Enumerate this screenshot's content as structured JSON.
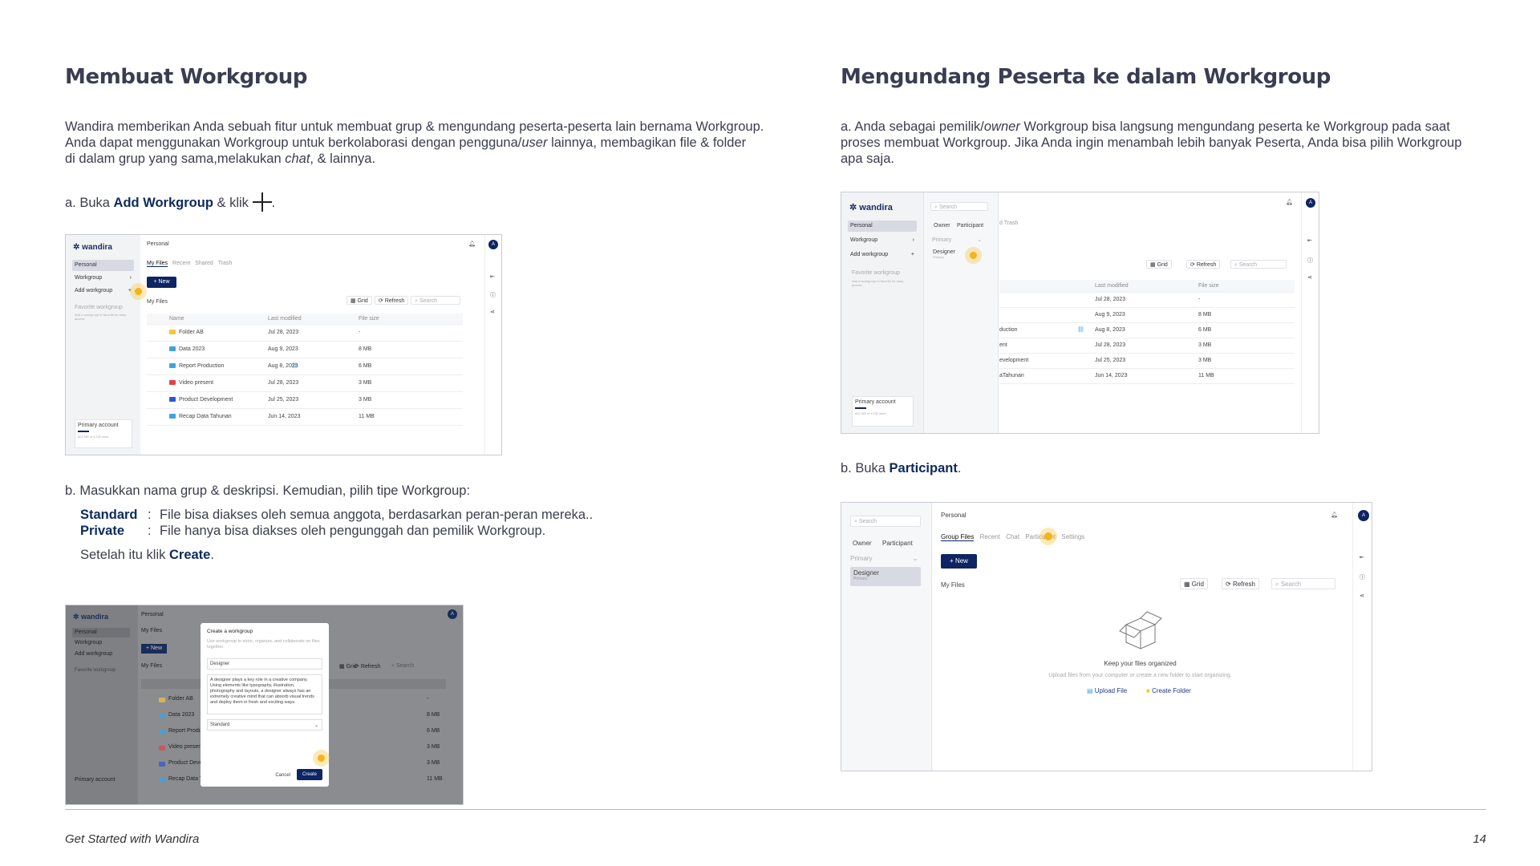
{
  "left": {
    "title": "Membuat Workgroup",
    "intro": [
      "Wandira memberikan Anda sebuah fitur untuk membuat grup & mengundang peserta-peserta lain bernama Workgroup.",
      "Anda dapat menggunakan Workgroup untuk berkolaborasi dengan pengguna/",
      "user",
      " lainnya, membagikan file & folder",
      "di dalam grup yang sama,melakukan ",
      "chat",
      ", & lainnya."
    ],
    "step_a": {
      "prefix": "a. Buka ",
      "bold": "Add Workgroup",
      "suffix": " & klik ",
      "end": "."
    },
    "step_b": "b. Masukkan nama grup & deskripsi. Kemudian, pilih tipe Workgroup:",
    "types": [
      {
        "name": "Standard",
        "sep": ":",
        "desc": "File bisa diakses oleh semua anggota, berdasarkan peran-peran mereka.."
      },
      {
        "name": "Private",
        "sep": ":",
        "desc": "File hanya bisa diakses oleh pengunggah dan pemilik Workgroup."
      }
    ],
    "after": {
      "prefix": "Setelah itu klik ",
      "bold": "Create",
      "end": "."
    }
  },
  "right": {
    "title": "Mengundang Peserta ke dalam Workgroup",
    "intro": [
      "a. Anda sebagai pemilik/",
      "owner",
      " Workgroup bisa langsung mengundang peserta ke Workgroup pada saat",
      "proses membuat Workgroup. Jika Anda ingin menambah lebih banyak Peserta, Anda bisa pilih Workgroup",
      "apa saja."
    ],
    "step_b": {
      "prefix": "b. Buka ",
      "bold": "Participant",
      "end": "."
    }
  },
  "app": {
    "logo": "wandira",
    "avatar": "A",
    "sidebar": [
      "Personal",
      "Workgroup",
      "Add workgroup"
    ],
    "fav_title": "Favorite workgroup",
    "fav_desc": "Add a workgroup to favorite for easy access",
    "primary_account": "Primary account",
    "storage": "802 MB of 5 GB used",
    "header": "Personal",
    "tabs": [
      "My Files",
      "Recent",
      "Shared",
      "Trash"
    ],
    "new": "+ New",
    "myfiles": "My Files",
    "grid": "Grid",
    "refresh": "Refresh",
    "search": "Search",
    "columns": [
      "Name",
      "Last modified",
      "File size"
    ],
    "files": [
      {
        "name": "Folder AB",
        "date": "Jul 28, 2023",
        "size": "-",
        "color": "#f4c542"
      },
      {
        "name": "Data 2023",
        "date": "Aug 9, 2023",
        "size": "8 MB",
        "color": "#3fa3e0"
      },
      {
        "name": "Report Production",
        "date": "Aug 8, 2023",
        "size": "6 MB",
        "color": "#3fa3e0"
      },
      {
        "name": "Video present",
        "date": "Jul 28, 2023",
        "size": "3 MB",
        "color": "#e04444"
      },
      {
        "name": "Product Development",
        "date": "Jul 25, 2023",
        "size": "3 MB",
        "color": "#2b56d6"
      },
      {
        "name": "Recap Data Tahunan",
        "date": "Jun 14, 2023",
        "size": "11 MB",
        "color": "#3fa3e0"
      }
    ]
  },
  "modal": {
    "title": "Create a workgroup",
    "desc": "Use workgroup to store, organize, and collaborate on files together.",
    "name": "Designer",
    "text": "A designer plays a key role in a creative company. Using elements like typography, illustration, photography and layouts, a designer always has an extremely creative mind that can absorb visual trends and deploy them in fresh and exciting ways.",
    "type": "Standard",
    "cancel": "Cancel",
    "create": "Create"
  },
  "panel": {
    "search": "Search",
    "tabs": [
      "Owner",
      "Participant"
    ],
    "group": "Primary",
    "item": "Designer",
    "item_sub": "Primary",
    "partial_tabs": "d   Trash",
    "partial_files": [
      "",
      "",
      "duction",
      "ent",
      "evelopment",
      "aTahunan"
    ]
  },
  "group_view": {
    "header": "Personal",
    "tabs": [
      "Group Files",
      "Recent",
      "Chat",
      "Participant",
      "Settings"
    ],
    "new": "+ New",
    "myfiles": "My Files",
    "empty_title": "Keep your files organized",
    "empty_desc": "Upload files from your computer or create a new folder to start organizing.",
    "upload": "Upload File",
    "create_folder": "Create Folder"
  },
  "footer": {
    "title": "Get Started with Wandira",
    "page": "14"
  }
}
